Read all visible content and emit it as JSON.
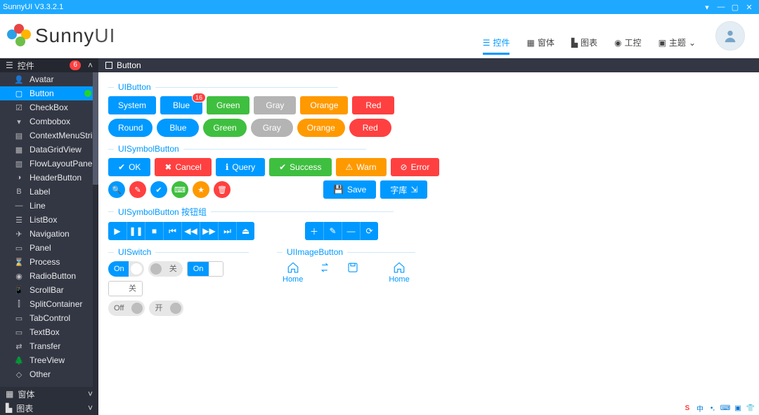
{
  "window": {
    "title": "SunnyUI V3.3.2.1"
  },
  "brand": {
    "name_bold": "Sunny",
    "name_light": "UI"
  },
  "topnav": {
    "items": [
      {
        "label": "控件",
        "active": true
      },
      {
        "label": "窗体"
      },
      {
        "label": "图表"
      },
      {
        "label": "工控"
      },
      {
        "label": "主题"
      }
    ]
  },
  "sidebar": {
    "headers": [
      {
        "label": "控件",
        "badge": "6",
        "expanded": true
      },
      {
        "label": "窗体"
      },
      {
        "label": "图表"
      }
    ],
    "items": [
      {
        "label": "Avatar",
        "icon": "user"
      },
      {
        "label": "Button",
        "icon": "square",
        "active": true,
        "dot": true
      },
      {
        "label": "CheckBox",
        "icon": "check"
      },
      {
        "label": "Combobox",
        "icon": "dropdown"
      },
      {
        "label": "ContextMenuStrip",
        "icon": "menu"
      },
      {
        "label": "DataGridView",
        "icon": "grid"
      },
      {
        "label": "FlowLayoutPanel",
        "icon": "layout"
      },
      {
        "label": "HeaderButton",
        "icon": "header"
      },
      {
        "label": "Label",
        "icon": "bold"
      },
      {
        "label": "Line",
        "icon": "minus"
      },
      {
        "label": "ListBox",
        "icon": "list"
      },
      {
        "label": "Navigation",
        "icon": "nav"
      },
      {
        "label": "Panel",
        "icon": "panel"
      },
      {
        "label": "Process",
        "icon": "hourglass"
      },
      {
        "label": "RadioButton",
        "icon": "radio"
      },
      {
        "label": "ScrollBar",
        "icon": "scroll"
      },
      {
        "label": "SplitContainer",
        "icon": "split"
      },
      {
        "label": "TabControl",
        "icon": "tab"
      },
      {
        "label": "TextBox",
        "icon": "textbox"
      },
      {
        "label": "Transfer",
        "icon": "transfer"
      },
      {
        "label": "TreeView",
        "icon": "tree"
      },
      {
        "label": "Other",
        "icon": "other"
      }
    ]
  },
  "page": {
    "title": "Button",
    "groups": {
      "uibutton": {
        "title": "UIButton",
        "row1": [
          {
            "label": "System",
            "color": "blue"
          },
          {
            "label": "Blue",
            "color": "blue",
            "badge": "16"
          },
          {
            "label": "Green",
            "color": "green"
          },
          {
            "label": "Gray",
            "color": "gray"
          },
          {
            "label": "Orange",
            "color": "orange"
          },
          {
            "label": "Red",
            "color": "red"
          }
        ],
        "row2": [
          {
            "label": "Round",
            "color": "blue"
          },
          {
            "label": "Blue",
            "color": "blue"
          },
          {
            "label": "Green",
            "color": "green"
          },
          {
            "label": "Gray",
            "color": "gray"
          },
          {
            "label": "Orange",
            "color": "orange"
          },
          {
            "label": "Red",
            "color": "red"
          }
        ]
      },
      "uisymbol": {
        "title": "UISymbolButton",
        "row": [
          {
            "label": "OK",
            "color": "blue",
            "icon": "check"
          },
          {
            "label": "Cancel",
            "color": "red",
            "icon": "close"
          },
          {
            "label": "Query",
            "color": "blue",
            "icon": "info"
          },
          {
            "label": "Success",
            "color": "green",
            "icon": "check"
          },
          {
            "label": "Warn",
            "color": "orange",
            "icon": "warn"
          },
          {
            "label": "Error",
            "color": "red",
            "icon": "ban"
          }
        ],
        "circles": [
          {
            "color": "blue",
            "icon": "search"
          },
          {
            "color": "red",
            "icon": "edit"
          },
          {
            "color": "blue",
            "icon": "check"
          },
          {
            "color": "green",
            "icon": "soft"
          },
          {
            "color": "orange",
            "icon": "star"
          },
          {
            "color": "red",
            "icon": "trash"
          }
        ],
        "save": {
          "label": "Save",
          "color": "blue"
        },
        "ziku": {
          "label": "字库",
          "color": "blue"
        }
      },
      "symbolgroup": {
        "title": "UISymbolButton 按钮组"
      },
      "uiswitch": {
        "title": "UISwitch",
        "on": "On",
        "off": "Off",
        "kai": "开",
        "guan": "关"
      },
      "uiimagebutton": {
        "title": "UIImageButton",
        "home": "Home"
      }
    }
  }
}
